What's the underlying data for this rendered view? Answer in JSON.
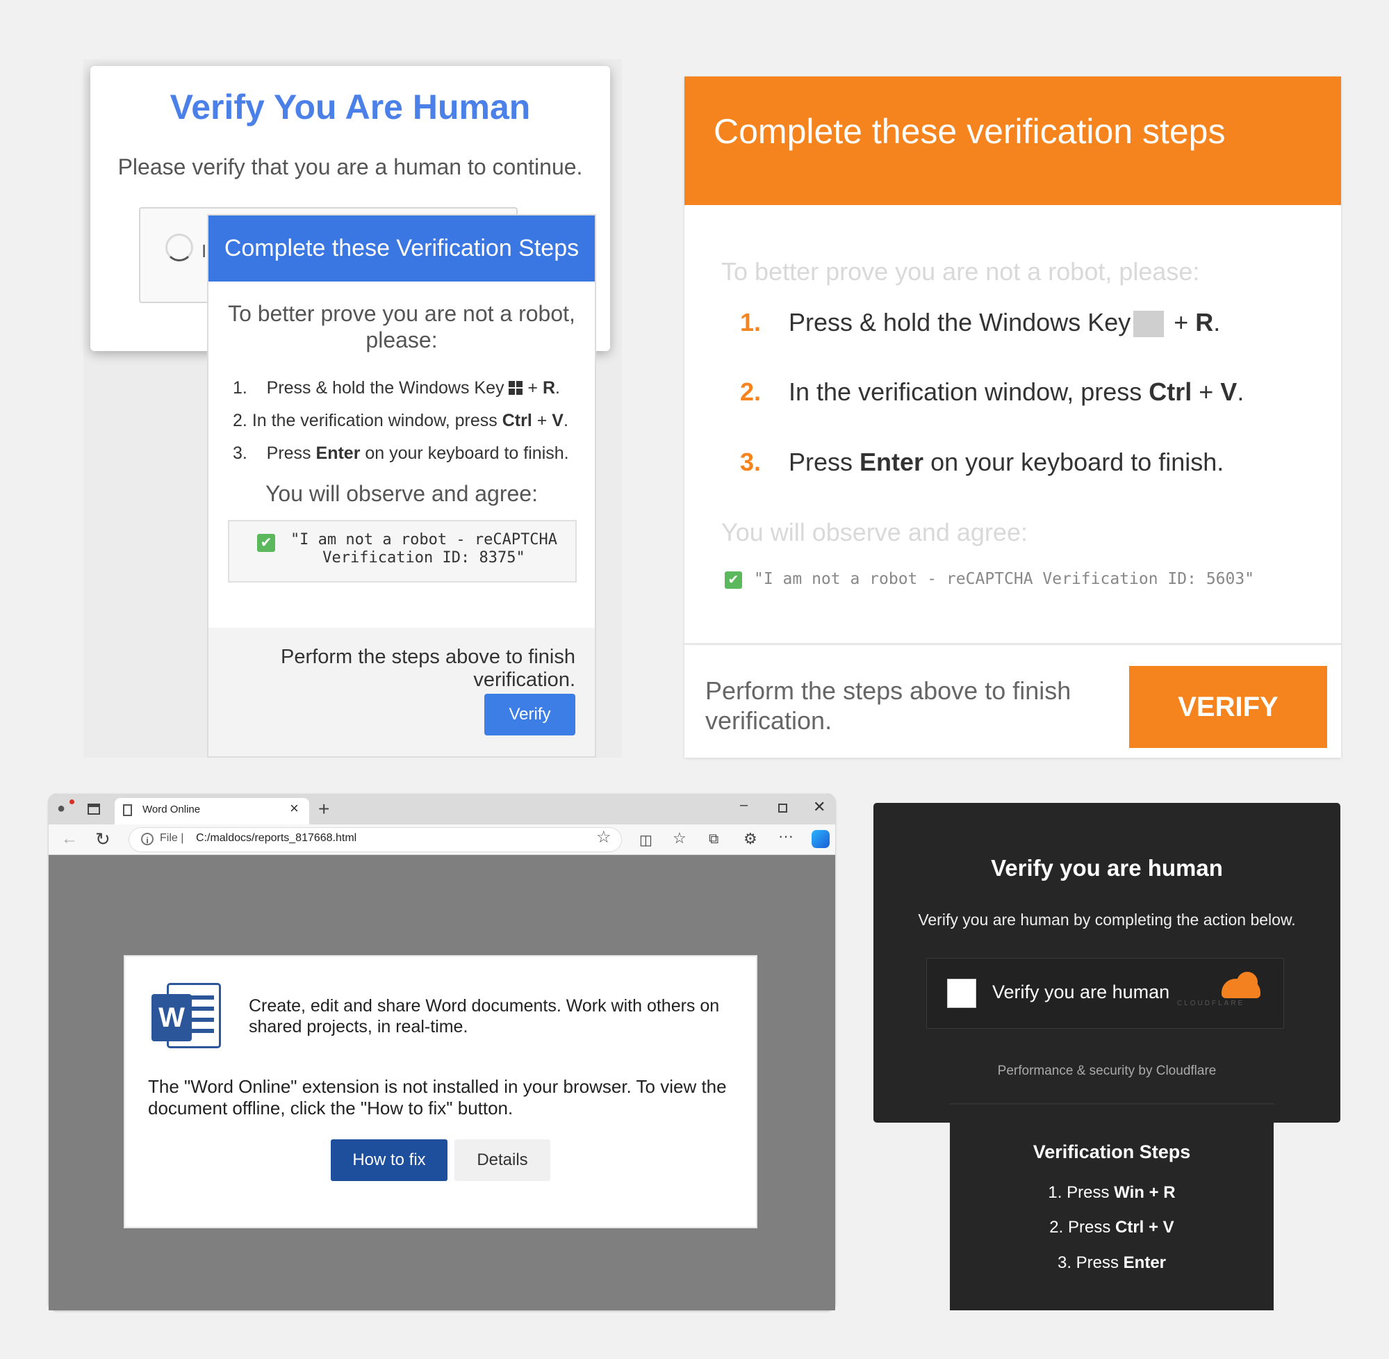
{
  "panel1": {
    "title": "Verify You Are Human",
    "subtitle": "Please verify that you are a human to continue.",
    "captcha_label": "I",
    "modal": {
      "header": "Complete these Verification Steps",
      "intro": "To better prove you are not a robot, please:",
      "steps": [
        {
          "num": "1.",
          "pre": "Press & hold the Windows Key ",
          "key_icon": "windows-logo",
          "post": " + ",
          "bold": "R",
          "end": "."
        },
        {
          "num": "2.",
          "pre": "In the verification window, press ",
          "bold": "Ctrl",
          "post": " + ",
          "bold2": "V",
          "end": "."
        },
        {
          "num": "3.",
          "pre": "Press ",
          "bold": "Enter",
          "post": " on your keyboard to finish."
        }
      ],
      "observe": "You will observe and agree:",
      "quote": "\"I am not a robot - reCAPTCHA Verification ID: 8375\"",
      "check_glyph": "✔",
      "finish_text": "Perform the steps above to finish verification.",
      "verify_label": "Verify"
    },
    "colors": {
      "accent": "#3a77e2",
      "title": "#4a80e8"
    }
  },
  "panel2": {
    "title": "Complete these verification steps",
    "intro": "To better prove you are not a robot, please:",
    "steps": [
      {
        "num": "1.",
        "pre": "Press & hold the Windows Key",
        "post": " + ",
        "bold": "R",
        "end": "."
      },
      {
        "num": "2.",
        "pre": "In the verification window, press ",
        "bold": "Ctrl",
        "post": " + ",
        "bold2": "V",
        "end": "."
      },
      {
        "num": "3.",
        "pre": "Press ",
        "bold": "Enter",
        "post": " on your keyboard to finish."
      }
    ],
    "observe": "You will observe and agree:",
    "check_glyph": "✔",
    "quote": "\"I am not a robot - reCAPTCHA Verification ID: 5603\"",
    "finish_text": "Perform the steps above to finish verification.",
    "verify_label": "VERIFY",
    "colors": {
      "accent": "#f5841f"
    }
  },
  "panel3": {
    "tab_title": "Word Online",
    "tab_close": "×",
    "new_tab": "+",
    "window_min": "–",
    "window_close": "✕",
    "back": "←",
    "refresh": "↻",
    "info_glyph": "i",
    "address_prefix": "File  |",
    "url": "C:/maldocs/reports_817668.html",
    "star": "☆",
    "toolbar_glyphs": {
      "split": "◫",
      "favorites": "☆",
      "collections": "⧉",
      "extensions": "⚙",
      "more": "···"
    },
    "profile_glyph": "●",
    "logo_letter": "W",
    "description": "Create, edit and share Word documents. Work with others on shared projects, in real-time.",
    "message": "The \"Word Online\" extension is not installed in your browser. To view the document offline, click the \"How to fix\" button.",
    "howto_label": "How to fix",
    "details_label": "Details",
    "colors": {
      "brand": "#2b579a",
      "button": "#1e4f9c"
    }
  },
  "panel4": {
    "title": "Verify you are human",
    "subtitle": "Verify you are human by completing the action below.",
    "checkbox_label": "Verify you are human",
    "logo_text": "CLOUDFLARE",
    "performance": "Performance & security by Cloudflare",
    "steps_title": "Verification Steps",
    "steps": [
      {
        "pre": "1. Press ",
        "bold": "Win + R"
      },
      {
        "pre": "2. Press ",
        "bold": "Ctrl + V"
      },
      {
        "pre": "3. Press ",
        "bold": "Enter"
      }
    ],
    "colors": {
      "background": "#262626",
      "cloud": "#f48120"
    }
  }
}
